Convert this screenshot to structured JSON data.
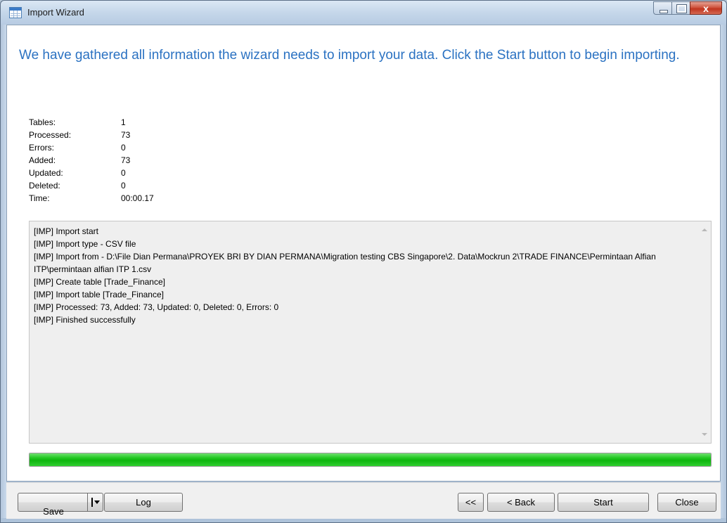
{
  "window": {
    "title": "Import Wizard"
  },
  "heading": "We have gathered all information the wizard needs to import your data. Click the Start button to begin importing.",
  "stats": [
    {
      "label": "Tables:",
      "value": "1"
    },
    {
      "label": "Processed:",
      "value": "73"
    },
    {
      "label": "Errors:",
      "value": "0"
    },
    {
      "label": "Added:",
      "value": "73"
    },
    {
      "label": "Updated:",
      "value": "0"
    },
    {
      "label": "Deleted:",
      "value": "0"
    },
    {
      "label": "Time:",
      "value": "00:00.17"
    }
  ],
  "log": [
    "[IMP] Import start",
    "[IMP] Import type - CSV file",
    "[IMP] Import from - D:\\File Dian Permana\\PROYEK BRI BY DIAN PERMANA\\Migration testing CBS Singapore\\2. Data\\Mockrun 2\\TRADE FINANCE\\Permintaan Alfian ITP\\permintaan alfian ITP 1.csv",
    "[IMP] Create table [Trade_Finance]",
    "[IMP] Import table [Trade_Finance]",
    "[IMP] Processed: 73, Added: 73, Updated: 0, Deleted: 0, Errors: 0",
    "[IMP] Finished successfully"
  ],
  "progress": {
    "fraction": 1.0,
    "color": "#16bd16"
  },
  "buttons": {
    "save": "Save",
    "log": "Log",
    "first": "<<",
    "back": "< Back",
    "start": "Start",
    "close": "Close"
  },
  "icons": {
    "window_icon": "table-grid-icon",
    "minimize": "minimize-icon",
    "maximize": "maximize-icon",
    "close": "close-icon",
    "save_menu": "dropdown-arrow-icon"
  }
}
